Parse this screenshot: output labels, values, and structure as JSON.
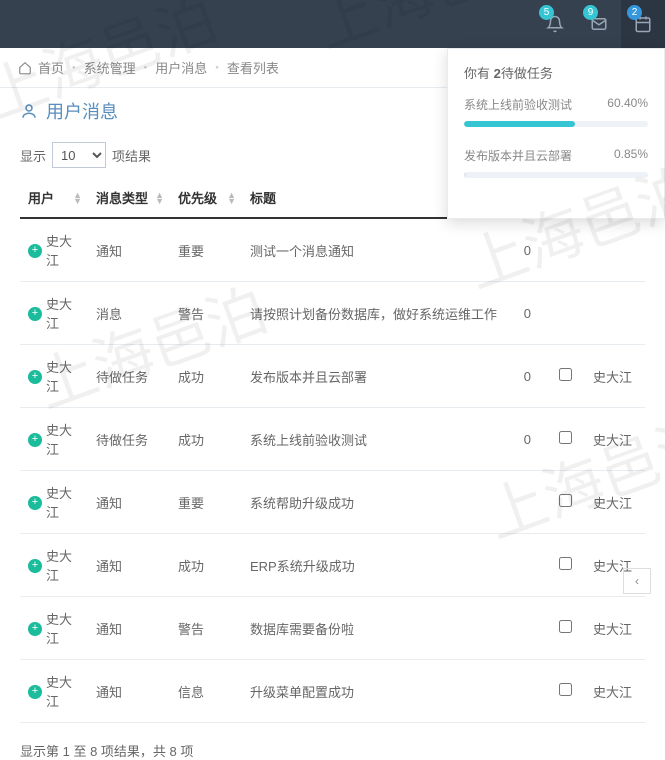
{
  "watermark_text": "上海邑泊",
  "topbar": {
    "notif_badge": "5",
    "mail_badge": "9",
    "task_badge": "2"
  },
  "breadcrumb": {
    "home": "首页",
    "a": "系统管理",
    "b": "用户消息",
    "c": "查看列表"
  },
  "page_title": "用户消息",
  "length": {
    "label_pre": "显示",
    "value": "10",
    "label_post": "项结果"
  },
  "columns": {
    "user": "用户",
    "type": "消息类型",
    "priority": "优先级",
    "title": "标题"
  },
  "rows": [
    {
      "user": "史大江",
      "type": "通知",
      "priority": "重要",
      "title": "测试一个消息通知",
      "r1": "0"
    },
    {
      "user": "史大江",
      "type": "消息",
      "priority": "警告",
      "title": "请按照计划备份数据库，做好系统运维工作",
      "r1": "0"
    },
    {
      "user": "史大江",
      "type": "待做任务",
      "priority": "成功",
      "title": "发布版本并且云部署",
      "r1": "0",
      "actor": "史大江"
    },
    {
      "user": "史大江",
      "type": "待做任务",
      "priority": "成功",
      "title": "系统上线前验收测试",
      "r1": "0",
      "actor": "史大江"
    },
    {
      "user": "史大江",
      "type": "通知",
      "priority": "重要",
      "title": "系统帮助升级成功",
      "r1": "",
      "actor": "史大江"
    },
    {
      "user": "史大江",
      "type": "通知",
      "priority": "成功",
      "title": "ERP系统升级成功",
      "r1": "",
      "actor": "史大江"
    },
    {
      "user": "史大江",
      "type": "通知",
      "priority": "警告",
      "title": "数据库需要备份啦",
      "r1": "",
      "actor": "史大江"
    },
    {
      "user": "史大江",
      "type": "通知",
      "priority": "信息",
      "title": "升级菜单配置成功",
      "r1": "",
      "actor": "史大江"
    }
  ],
  "footer_info": "显示第 1 至 8 项结果，共 8 项",
  "task_panel": {
    "header_pre": "你有 ",
    "header_count": "2",
    "header_post": "待做任务",
    "items": [
      {
        "name": "系统上线前验收测试",
        "pct_label": "60.40%",
        "pct": 60.4,
        "color": "teal"
      },
      {
        "name": "发布版本并且云部署",
        "pct_label": "0.85%",
        "pct": 0.85,
        "color": "grey"
      }
    ]
  }
}
